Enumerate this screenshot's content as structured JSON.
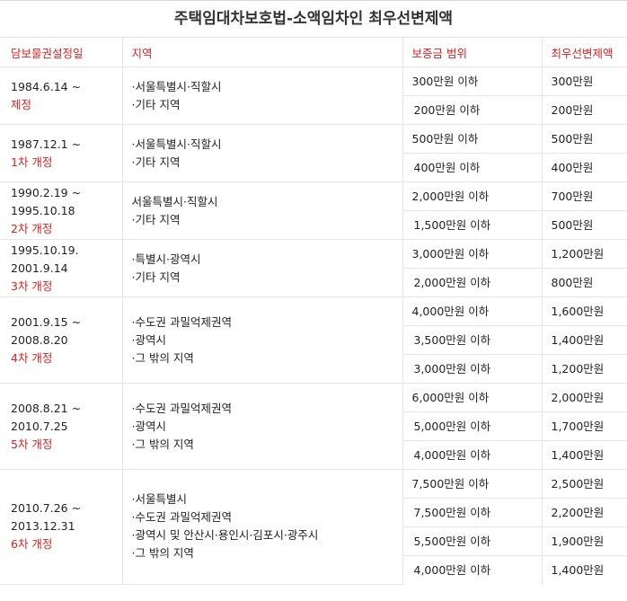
{
  "title": "주택임대차보호법-소액임차인 최우선변제액",
  "headers": {
    "date": "담보물권설정일",
    "region": "지역",
    "deposit": "보증금 범위",
    "payout": "최우선변제액"
  },
  "groups": [
    {
      "dates": [
        "1984.6.14 ~"
      ],
      "revision": "제정",
      "regions": [
        "·서울특별시·직할시",
        "·기타 지역"
      ],
      "rows": [
        {
          "deposit": "300만원 이하",
          "payout": "300만원"
        },
        {
          "deposit": "200만원 이하",
          "payout": "200만원"
        }
      ]
    },
    {
      "dates": [
        "1987.12.1 ~"
      ],
      "revision": "1차 개정",
      "regions": [
        "·서울특별시·직할시",
        "·기타 지역"
      ],
      "rows": [
        {
          "deposit": "500만원 이하",
          "payout": "500만원"
        },
        {
          "deposit": "400만원 이하",
          "payout": "400만원"
        }
      ]
    },
    {
      "dates": [
        "1990.2.19 ~",
        "1995.10.18"
      ],
      "revision": "2차 개정",
      "regions": [
        "서울특별시·직할시",
        "·기타 지역"
      ],
      "rows": [
        {
          "deposit": "2,000만원 이하",
          "payout": "700만원"
        },
        {
          "deposit": "1,500만원 이하",
          "payout": "500만원"
        }
      ]
    },
    {
      "dates": [
        "1995.10.19.",
        "2001.9.14"
      ],
      "revision": "3차 개정",
      "regions": [
        "·특별시·광역시",
        "·기타 지역"
      ],
      "rows": [
        {
          "deposit": "3,000만원 이하",
          "payout": "1,200만원"
        },
        {
          "deposit": "2,000만원 이하",
          "payout": "800만원"
        }
      ]
    },
    {
      "dates": [
        "2001.9.15 ~",
        "2008.8.20"
      ],
      "revision": "4차 개정",
      "regions": [
        "·수도권 과밀억제권역",
        "·광역시",
        "·그 밖의 지역"
      ],
      "rows": [
        {
          "deposit": "4,000만원 이하",
          "payout": "1,600만원"
        },
        {
          "deposit": "3,500만원 이하",
          "payout": "1,400만원"
        },
        {
          "deposit": "3,000만원 이하",
          "payout": "1,200만원"
        }
      ]
    },
    {
      "dates": [
        "2008.8.21 ~",
        "2010.7.25"
      ],
      "revision": "5차 개정",
      "regions": [
        "·수도권 과밀억제권역",
        "·광역시",
        "·그 밖의 지역"
      ],
      "rows": [
        {
          "deposit": "6,000만원 이하",
          "payout": "2,000만원"
        },
        {
          "deposit": "5,000만원 이하",
          "payout": "1,700만원"
        },
        {
          "deposit": "4,000만원 이하",
          "payout": "1,400만원"
        }
      ]
    },
    {
      "dates": [
        "2010.7.26 ~",
        "2013.12.31"
      ],
      "revision": "6차 개정",
      "regions": [
        "·서울특별시",
        "·수도권 과밀억제권역",
        "·광역시 및 안산시·용인시·김포시·광주시",
        "·그 밖의 지역"
      ],
      "rows": [
        {
          "deposit": "7,500만원 이하",
          "payout": "2,500만원"
        },
        {
          "deposit": "7,500만원 이하",
          "payout": "2,200만원"
        },
        {
          "deposit": "5,500만원 이하",
          "payout": "1,900만원"
        },
        {
          "deposit": "4,000만원 이하",
          "payout": "1,400만원"
        }
      ]
    }
  ],
  "colors": {
    "accent": "#e02020",
    "border": "#e3e3e3",
    "text": "#222222"
  }
}
